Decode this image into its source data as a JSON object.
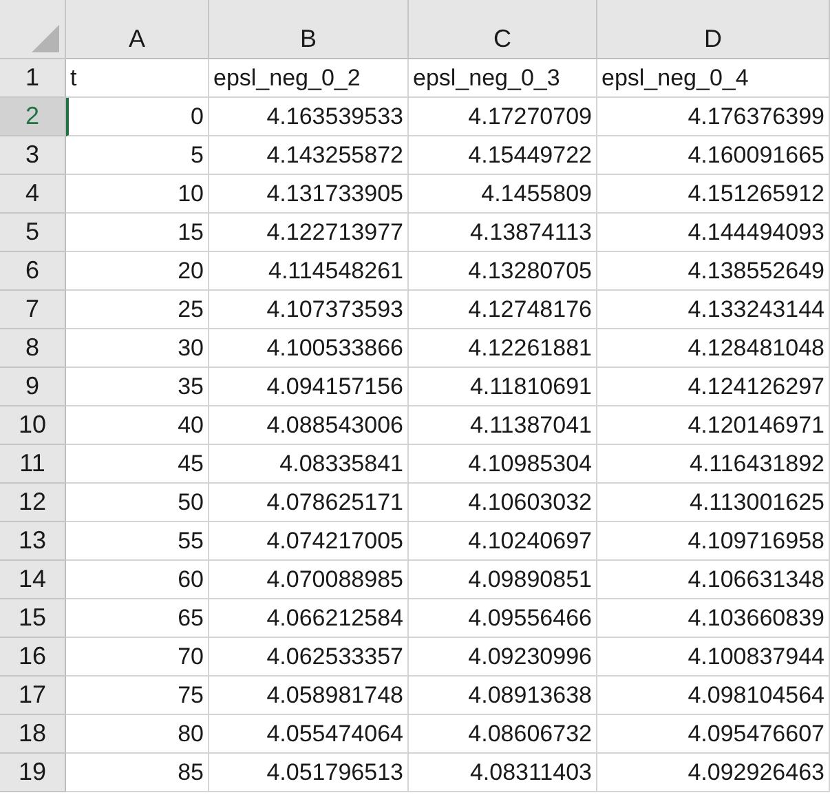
{
  "columns": [
    "A",
    "B",
    "C",
    "D"
  ],
  "rows": [
    {
      "number": "1",
      "selected": false,
      "cells": [
        {
          "text": "t",
          "kind": "text"
        },
        {
          "text": "epsl_neg_0_2",
          "kind": "text"
        },
        {
          "text": "epsl_neg_0_3",
          "kind": "text"
        },
        {
          "text": "epsl_neg_0_4",
          "kind": "text"
        }
      ]
    },
    {
      "number": "2",
      "selected": true,
      "cells": [
        {
          "text": "0",
          "kind": "number"
        },
        {
          "text": "4.163539533",
          "kind": "number"
        },
        {
          "text": "4.17270709",
          "kind": "number"
        },
        {
          "text": "4.176376399",
          "kind": "number"
        }
      ]
    },
    {
      "number": "3",
      "selected": false,
      "cells": [
        {
          "text": "5",
          "kind": "number"
        },
        {
          "text": "4.143255872",
          "kind": "number"
        },
        {
          "text": "4.15449722",
          "kind": "number"
        },
        {
          "text": "4.160091665",
          "kind": "number"
        }
      ]
    },
    {
      "number": "4",
      "selected": false,
      "cells": [
        {
          "text": "10",
          "kind": "number"
        },
        {
          "text": "4.131733905",
          "kind": "number"
        },
        {
          "text": "4.1455809",
          "kind": "number"
        },
        {
          "text": "4.151265912",
          "kind": "number"
        }
      ]
    },
    {
      "number": "5",
      "selected": false,
      "cells": [
        {
          "text": "15",
          "kind": "number"
        },
        {
          "text": "4.122713977",
          "kind": "number"
        },
        {
          "text": "4.13874113",
          "kind": "number"
        },
        {
          "text": "4.144494093",
          "kind": "number"
        }
      ]
    },
    {
      "number": "6",
      "selected": false,
      "cells": [
        {
          "text": "20",
          "kind": "number"
        },
        {
          "text": "4.114548261",
          "kind": "number"
        },
        {
          "text": "4.13280705",
          "kind": "number"
        },
        {
          "text": "4.138552649",
          "kind": "number"
        }
      ]
    },
    {
      "number": "7",
      "selected": false,
      "cells": [
        {
          "text": "25",
          "kind": "number"
        },
        {
          "text": "4.107373593",
          "kind": "number"
        },
        {
          "text": "4.12748176",
          "kind": "number"
        },
        {
          "text": "4.133243144",
          "kind": "number"
        }
      ]
    },
    {
      "number": "8",
      "selected": false,
      "cells": [
        {
          "text": "30",
          "kind": "number"
        },
        {
          "text": "4.100533866",
          "kind": "number"
        },
        {
          "text": "4.12261881",
          "kind": "number"
        },
        {
          "text": "4.128481048",
          "kind": "number"
        }
      ]
    },
    {
      "number": "9",
      "selected": false,
      "cells": [
        {
          "text": "35",
          "kind": "number"
        },
        {
          "text": "4.094157156",
          "kind": "number"
        },
        {
          "text": "4.11810691",
          "kind": "number"
        },
        {
          "text": "4.124126297",
          "kind": "number"
        }
      ]
    },
    {
      "number": "10",
      "selected": false,
      "cells": [
        {
          "text": "40",
          "kind": "number"
        },
        {
          "text": "4.088543006",
          "kind": "number"
        },
        {
          "text": "4.11387041",
          "kind": "number"
        },
        {
          "text": "4.120146971",
          "kind": "number"
        }
      ]
    },
    {
      "number": "11",
      "selected": false,
      "cells": [
        {
          "text": "45",
          "kind": "number"
        },
        {
          "text": "4.08335841",
          "kind": "number"
        },
        {
          "text": "4.10985304",
          "kind": "number"
        },
        {
          "text": "4.116431892",
          "kind": "number"
        }
      ]
    },
    {
      "number": "12",
      "selected": false,
      "cells": [
        {
          "text": "50",
          "kind": "number"
        },
        {
          "text": "4.078625171",
          "kind": "number"
        },
        {
          "text": "4.10603032",
          "kind": "number"
        },
        {
          "text": "4.113001625",
          "kind": "number"
        }
      ]
    },
    {
      "number": "13",
      "selected": false,
      "cells": [
        {
          "text": "55",
          "kind": "number"
        },
        {
          "text": "4.074217005",
          "kind": "number"
        },
        {
          "text": "4.10240697",
          "kind": "number"
        },
        {
          "text": "4.109716958",
          "kind": "number"
        }
      ]
    },
    {
      "number": "14",
      "selected": false,
      "cells": [
        {
          "text": "60",
          "kind": "number"
        },
        {
          "text": "4.070088985",
          "kind": "number"
        },
        {
          "text": "4.09890851",
          "kind": "number"
        },
        {
          "text": "4.106631348",
          "kind": "number"
        }
      ]
    },
    {
      "number": "15",
      "selected": false,
      "cells": [
        {
          "text": "65",
          "kind": "number"
        },
        {
          "text": "4.066212584",
          "kind": "number"
        },
        {
          "text": "4.09556466",
          "kind": "number"
        },
        {
          "text": "4.103660839",
          "kind": "number"
        }
      ]
    },
    {
      "number": "16",
      "selected": false,
      "cells": [
        {
          "text": "70",
          "kind": "number"
        },
        {
          "text": "4.062533357",
          "kind": "number"
        },
        {
          "text": "4.09230996",
          "kind": "number"
        },
        {
          "text": "4.100837944",
          "kind": "number"
        }
      ]
    },
    {
      "number": "17",
      "selected": false,
      "cells": [
        {
          "text": "75",
          "kind": "number"
        },
        {
          "text": "4.058981748",
          "kind": "number"
        },
        {
          "text": "4.08913638",
          "kind": "number"
        },
        {
          "text": "4.098104564",
          "kind": "number"
        }
      ]
    },
    {
      "number": "18",
      "selected": false,
      "cells": [
        {
          "text": "80",
          "kind": "number"
        },
        {
          "text": "4.055474064",
          "kind": "number"
        },
        {
          "text": "4.08606732",
          "kind": "number"
        },
        {
          "text": "4.095476607",
          "kind": "number"
        }
      ]
    },
    {
      "number": "19",
      "selected": false,
      "cells": [
        {
          "text": "85",
          "kind": "number"
        },
        {
          "text": "4.051796513",
          "kind": "number"
        },
        {
          "text": "4.08311403",
          "kind": "number"
        },
        {
          "text": "4.092926463",
          "kind": "number"
        }
      ]
    }
  ]
}
